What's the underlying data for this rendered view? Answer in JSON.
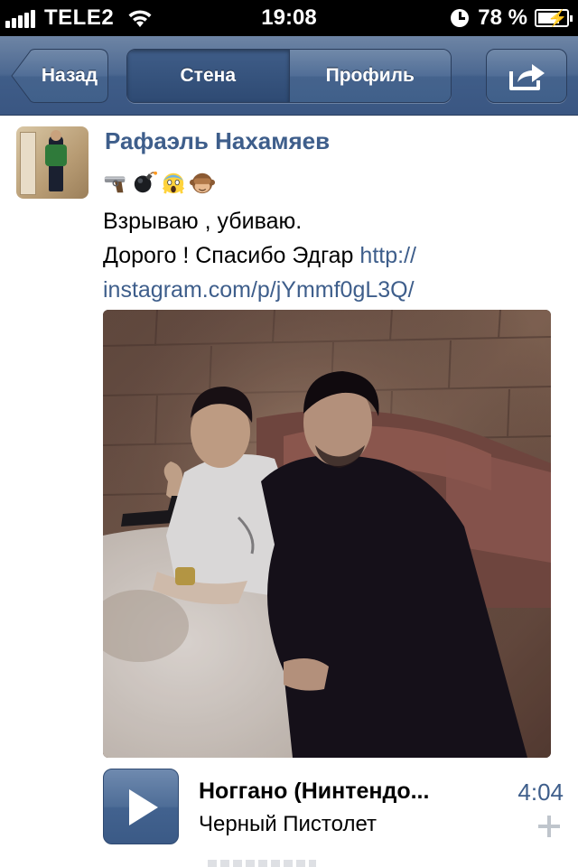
{
  "status_bar": {
    "carrier": "TELE2",
    "time": "19:08",
    "battery_percent": "78 %",
    "battery_level": 0.78,
    "signal_bars": 5
  },
  "nav": {
    "back_label": "Назад",
    "tabs": [
      {
        "label": "Стена",
        "active": true
      },
      {
        "label": "Профиль",
        "active": false
      }
    ],
    "share_icon": "share-icon"
  },
  "post": {
    "author": "Рафаэль Нахамяев",
    "emoji": [
      "pistol-emoji",
      "bomb-emoji",
      "scream-emoji",
      "see-no-evil-monkey-emoji"
    ],
    "text_line1": "Взрываю , убиваю.",
    "text_line2_prefix": "Дорого ! Спасибо Эдгар ",
    "link_part1": "http://",
    "link_part2": "instagram.com/p/jYmmf0gL3Q/"
  },
  "audio": {
    "title": "Ноггано (Нинтендо...",
    "artist": "Черный Пистолет",
    "duration": "4:04"
  },
  "colors": {
    "accent": "#3e5e8b",
    "nav_bar": "#4c6891"
  }
}
